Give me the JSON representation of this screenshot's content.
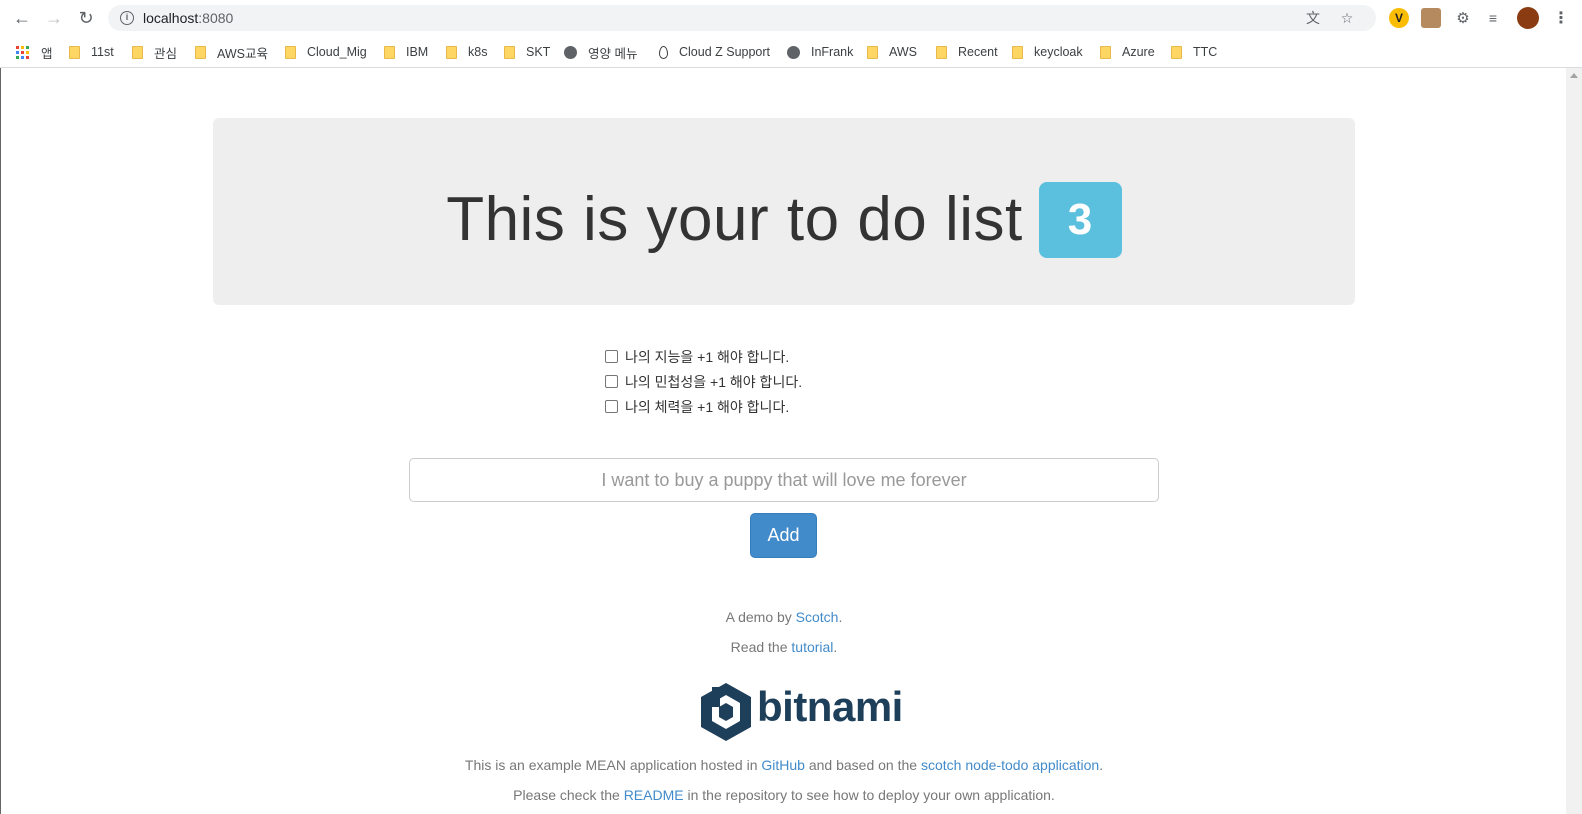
{
  "browser": {
    "url_host": "localhost",
    "url_port": ":8080",
    "bookmarks": [
      {
        "label": "앱",
        "icon": "apps-icon"
      },
      {
        "label": "11st",
        "icon": "folder-icon"
      },
      {
        "label": "관심",
        "icon": "folder-icon"
      },
      {
        "label": "AWS교육",
        "icon": "folder-icon"
      },
      {
        "label": "Cloud_Mig",
        "icon": "folder-icon"
      },
      {
        "label": "IBM",
        "icon": "folder-icon"
      },
      {
        "label": "k8s",
        "icon": "folder-icon"
      },
      {
        "label": "SKT",
        "icon": "folder-icon"
      },
      {
        "label": "영양 메뉴",
        "icon": "globe-icon"
      },
      {
        "label": "Cloud Z Support",
        "icon": "drop-icon"
      },
      {
        "label": "InFrank",
        "icon": "globe-icon"
      },
      {
        "label": "AWS",
        "icon": "folder-icon"
      },
      {
        "label": "Recent",
        "icon": "folder-icon"
      },
      {
        "label": "keycloak",
        "icon": "folder-icon"
      },
      {
        "label": "Azure",
        "icon": "folder-icon"
      },
      {
        "label": "TTC",
        "icon": "folder-icon"
      }
    ]
  },
  "header": {
    "title": "This is your to do list",
    "count": "3",
    "badge_color": "#5bc0de"
  },
  "todos": [
    "나의 지능을 +1 해야 합니다.",
    "나의 민첩성을 +1 해야 합니다.",
    "나의 체력을 +1 해야 합니다."
  ],
  "form": {
    "placeholder": "I want to buy a puppy that will love me forever",
    "add_label": "Add",
    "button_color": "#428bca"
  },
  "footer": {
    "demo_prefix": "A demo by ",
    "demo_link": "Scotch",
    "demo_suffix": ".",
    "read_prefix": "Read the ",
    "read_link": "tutorial",
    "read_suffix": ".",
    "logo_text": "bitnami",
    "example_prefix": "This is an example MEAN application hosted in ",
    "example_link1": "GitHub",
    "example_middle": " and based on the ",
    "example_link2": "scotch node-todo application",
    "example_suffix": ".",
    "check_prefix": "Please check the ",
    "check_link": "README",
    "check_suffix": " in the repository to see how to deploy your own application."
  }
}
